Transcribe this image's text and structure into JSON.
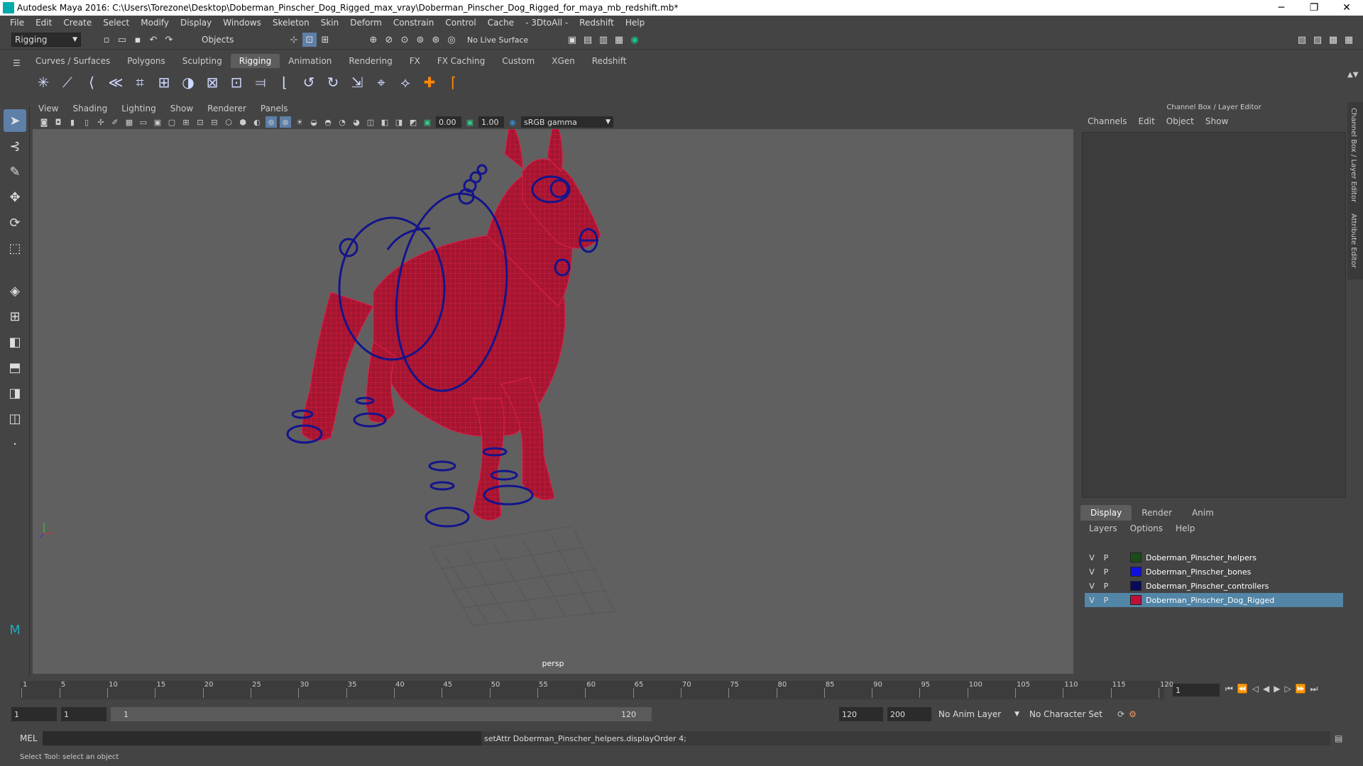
{
  "window": {
    "title": "Autodesk Maya 2016: C:\\Users\\Torezone\\Desktop\\Doberman_Pinscher_Dog_Rigged_max_vray\\Doberman_Pinscher_Dog_Rigged_for_maya_mb_redshift.mb*"
  },
  "menubar": [
    "File",
    "Edit",
    "Create",
    "Select",
    "Modify",
    "Display",
    "Windows",
    "Skeleton",
    "Skin",
    "Deform",
    "Constrain",
    "Control",
    "Cache",
    "- 3DtoAll -",
    "Redshift",
    "Help"
  ],
  "statusline": {
    "menuset": "Rigging",
    "selection_mode": "Objects",
    "live_surface": "No Live Surface"
  },
  "shelf_tabs": [
    "Curves / Surfaces",
    "Polygons",
    "Sculpting",
    "Rigging",
    "Animation",
    "Rendering",
    "FX",
    "FX Caching",
    "Custom",
    "XGen",
    "Redshift"
  ],
  "active_shelf_tab": "Rigging",
  "viewport": {
    "menu": [
      "View",
      "Shading",
      "Lighting",
      "Show",
      "Renderer",
      "Panels"
    ],
    "exposure": "0.00",
    "gamma": "1.00",
    "color_space": "sRGB gamma",
    "camera_label": "persp"
  },
  "channelbox": {
    "title": "Channel Box / Layer Editor",
    "menu": [
      "Channels",
      "Edit",
      "Object",
      "Show"
    ],
    "layer_tabs": [
      "Display",
      "Render",
      "Anim"
    ],
    "active_layer_tab": "Display",
    "layer_menu": [
      "Layers",
      "Options",
      "Help"
    ],
    "layers": [
      {
        "v": "V",
        "p": "P",
        "name": "Doberman_Pinscher_helpers",
        "color": "#1a4d1a",
        "selected": false
      },
      {
        "v": "V",
        "p": "P",
        "name": "Doberman_Pinscher_bones",
        "color": "#1010e0",
        "selected": false
      },
      {
        "v": "V",
        "p": "P",
        "name": "Doberman_Pinscher_controllers",
        "color": "#0a0a5a",
        "selected": false
      },
      {
        "v": "V",
        "p": "P",
        "name": "Doberman_Pinscher_Dog_Rigged",
        "color": "#c0103a",
        "selected": true
      }
    ]
  },
  "side_tabs": [
    "Channel Box / Layer Editor",
    "Attribute Editor"
  ],
  "timeslider": {
    "ticks": [
      "1",
      "5",
      "10",
      "15",
      "20",
      "25",
      "30",
      "35",
      "40",
      "45",
      "50",
      "55",
      "60",
      "65",
      "70",
      "75",
      "80",
      "85",
      "90",
      "95",
      "100",
      "105",
      "110",
      "115",
      "120"
    ],
    "current_frame": "1"
  },
  "range": {
    "start": "1",
    "inner_start": "1",
    "range_start_label": "1",
    "range_end_label": "120",
    "end": "120",
    "anim_end": "200",
    "anim_layer": "No Anim Layer",
    "character_set": "No Character Set"
  },
  "cmdline": {
    "lang": "MEL",
    "output": "setAttr Doberman_Pinscher_helpers.displayOrder 4;"
  },
  "helpline": "Select Tool: select an object"
}
